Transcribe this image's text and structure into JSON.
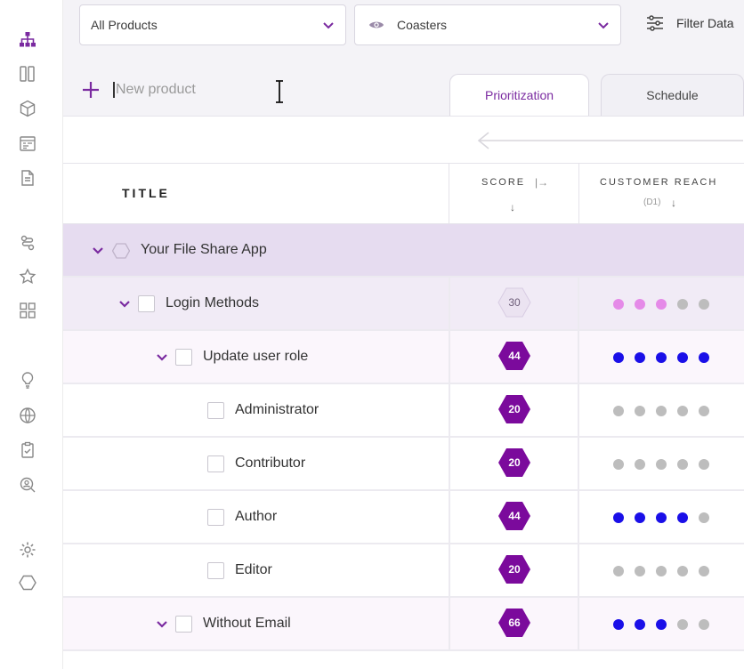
{
  "colors": {
    "accent": "#7a2aa0",
    "score_dark": "#7b0a9c",
    "score_light": "#ebe3f1",
    "dot_blue": "#1a0fe8",
    "dot_pink": "#e58ae8",
    "dot_gray": "#bdbdbd"
  },
  "sidebar": {
    "icons": [
      "hierarchy-icon",
      "board-icon",
      "cube-icon",
      "calendar-icon",
      "document-icon",
      "workflow-icon",
      "star-icon",
      "grid-icon",
      "lightbulb-icon",
      "globe-icon",
      "clipboard-check-icon",
      "search-person-icon",
      "gear-icon",
      "hexagon-icon"
    ]
  },
  "toolbar": {
    "products_select": "All Products",
    "view_select": "Coasters",
    "filter_label": "Filter Data"
  },
  "new_product": {
    "placeholder": "New product"
  },
  "tabs": [
    {
      "label": "Prioritization",
      "active": true
    },
    {
      "label": "Schedule",
      "active": false
    }
  ],
  "columns": {
    "title": "TITLE",
    "score": "SCORE",
    "reach": "CUSTOMER REACH",
    "reach_sub": "(D1)"
  },
  "rows": [
    {
      "label": "Your File Share App",
      "type": "group",
      "score": null,
      "dots": []
    },
    {
      "label": "Login Methods",
      "type": "lvl1",
      "score": "30",
      "score_style": "light",
      "dots": [
        "pink",
        "pink",
        "pink",
        "gray",
        "gray"
      ]
    },
    {
      "label": "Update user role",
      "type": "lvl2",
      "score": "44",
      "score_style": "dark",
      "dots": [
        "blue",
        "blue",
        "blue",
        "blue",
        "blue"
      ]
    },
    {
      "label": "Administrator",
      "type": "leaf",
      "score": "20",
      "score_style": "dark",
      "dots": [
        "gray",
        "gray",
        "gray",
        "gray",
        "gray"
      ]
    },
    {
      "label": "Contributor",
      "type": "leaf",
      "score": "20",
      "score_style": "dark",
      "dots": [
        "gray",
        "gray",
        "gray",
        "gray",
        "gray"
      ]
    },
    {
      "label": "Author",
      "type": "leaf",
      "score": "44",
      "score_style": "dark",
      "dots": [
        "blue",
        "blue",
        "blue",
        "blue",
        "gray"
      ]
    },
    {
      "label": "Editor",
      "type": "leaf",
      "score": "20",
      "score_style": "dark",
      "dots": [
        "gray",
        "gray",
        "gray",
        "gray",
        "gray"
      ]
    },
    {
      "label": "Without Email",
      "type": "lvl2",
      "score": "66",
      "score_style": "dark",
      "dots": [
        "blue",
        "blue",
        "blue",
        "gray",
        "gray"
      ]
    }
  ]
}
